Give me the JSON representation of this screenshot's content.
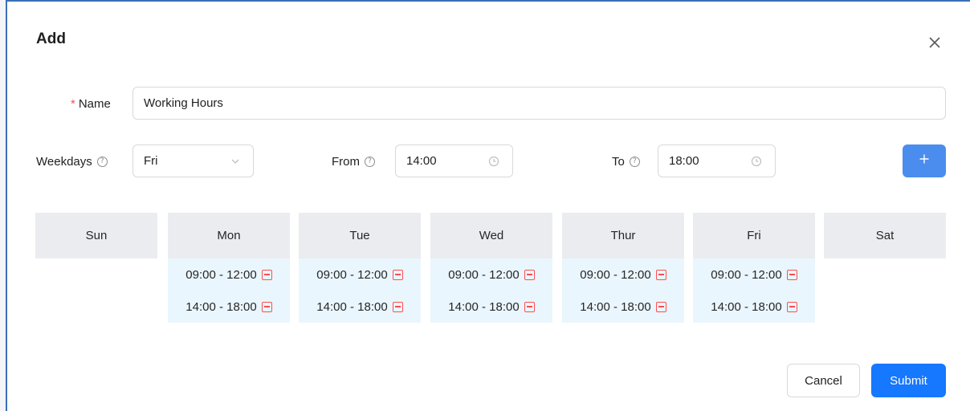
{
  "dialog": {
    "title": "Add",
    "close_icon": "close-icon"
  },
  "form": {
    "name": {
      "label": "Name",
      "required_mark": "*",
      "value": "Working Hours"
    },
    "weekdays": {
      "label": "Weekdays",
      "value": "Fri",
      "help_icon": "question-circle-icon",
      "suffix_icon": "chevron-down-icon"
    },
    "from": {
      "label": "From",
      "value": "14:00",
      "help_icon": "question-circle-icon",
      "suffix_icon": "clock-icon"
    },
    "to": {
      "label": "To",
      "value": "18:00",
      "help_icon": "question-circle-icon",
      "suffix_icon": "clock-icon"
    },
    "add_icon": "plus-icon"
  },
  "schedule": {
    "days": [
      {
        "name": "Sun",
        "slots": []
      },
      {
        "name": "Mon",
        "slots": [
          "09:00 - 12:00",
          "14:00 - 18:00"
        ]
      },
      {
        "name": "Tue",
        "slots": [
          "09:00 - 12:00",
          "14:00 - 18:00"
        ]
      },
      {
        "name": "Wed",
        "slots": [
          "09:00 - 12:00",
          "14:00 - 18:00"
        ]
      },
      {
        "name": "Thur",
        "slots": [
          "09:00 - 12:00",
          "14:00 - 18:00"
        ]
      },
      {
        "name": "Fri",
        "slots": [
          "09:00 - 12:00",
          "14:00 - 18:00"
        ]
      },
      {
        "name": "Sat",
        "slots": []
      }
    ],
    "remove_icon": "minus-square-icon"
  },
  "footer": {
    "cancel_label": "Cancel",
    "submit_label": "Submit"
  },
  "colors": {
    "primary": "#1677ff",
    "add_button": "#4a8dee",
    "required": "#ff4d4f",
    "slot_background": "#eaf6fd",
    "day_header_background": "#ebecf0"
  }
}
